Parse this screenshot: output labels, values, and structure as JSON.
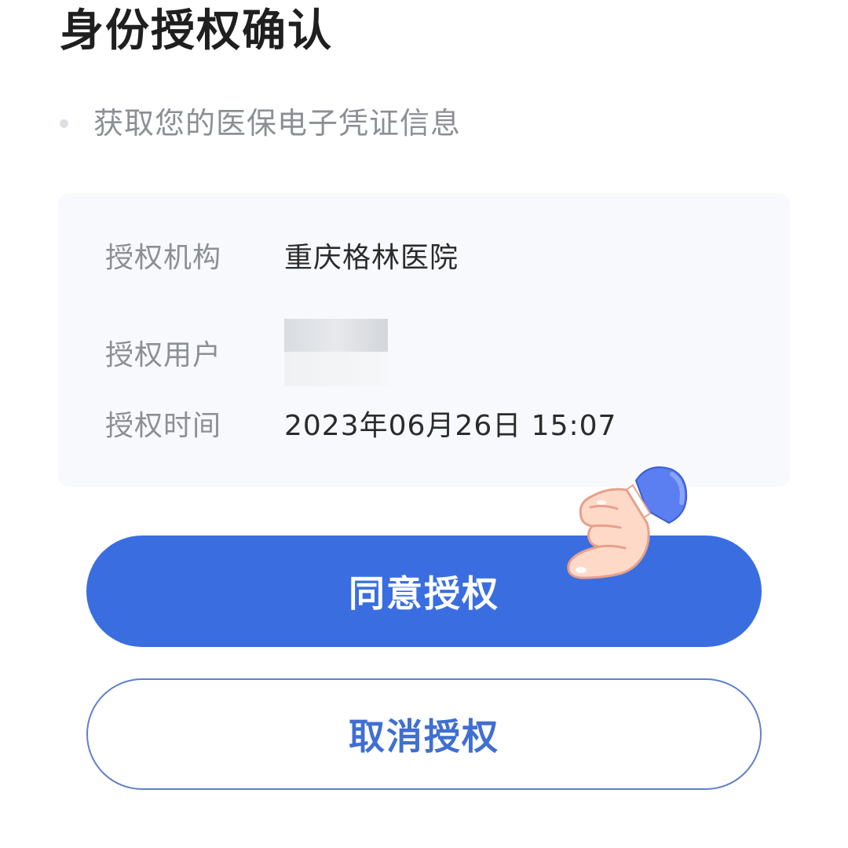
{
  "header": {
    "title": "身份授权确认"
  },
  "scope": {
    "items": [
      {
        "text": "获取您的医保电子凭证信息"
      }
    ]
  },
  "details": {
    "rows": [
      {
        "label": "授权机构",
        "value": "重庆格林医院"
      },
      {
        "label": "授权用户",
        "value": ""
      },
      {
        "label": "授权时间",
        "value": "2023年06月26日 15:07"
      }
    ]
  },
  "actions": {
    "agree_label": "同意授权",
    "cancel_label": "取消授权"
  },
  "overlay": {
    "pointer_icon": "pointing-hand-icon"
  },
  "colors": {
    "primary": "#3a6ee0",
    "cancel_text": "#3f6fd2",
    "cancel_border": "#5f82c7",
    "card_bg": "#f7f9fc",
    "label_text": "#8c8f94",
    "value_text": "#2b2b2b"
  }
}
